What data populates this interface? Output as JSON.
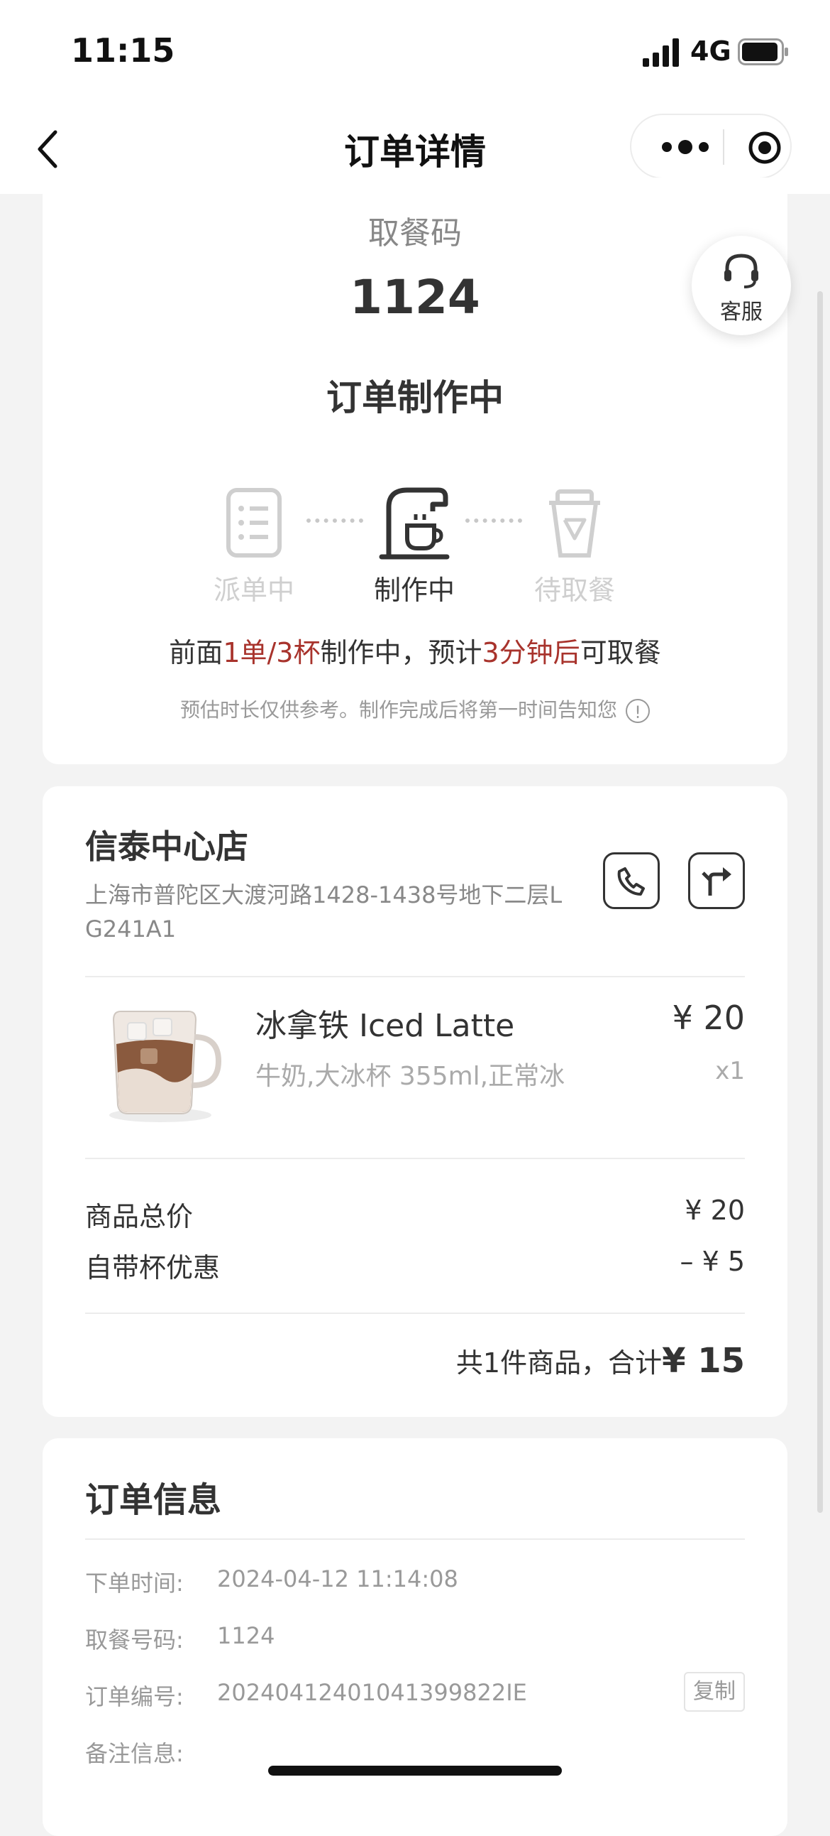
{
  "status_bar": {
    "time": "11:15",
    "network": "4G"
  },
  "nav": {
    "title": "订单详情"
  },
  "customer_service": {
    "label": "客服"
  },
  "pickup": {
    "label": "取餐码",
    "code": "1124",
    "status": "订单制作中"
  },
  "progress": {
    "steps": [
      {
        "label": "派单中",
        "state": "done",
        "icon": "order-list-icon"
      },
      {
        "label": "制作中",
        "state": "active",
        "icon": "coffee-machine-icon"
      },
      {
        "label": "待取餐",
        "state": "pending",
        "icon": "cup-icon"
      }
    ],
    "queue_prefix": "前面",
    "queue_count": "1单/3杯",
    "queue_mid": "制作中，预计",
    "queue_wait": "3分钟后",
    "queue_suffix": "可取餐",
    "note": "预估时长仅供参考。制作完成后将第一时间告知您",
    "note_icon": "!",
    "highlight_color": "#a8332c"
  },
  "store": {
    "name": "信泰中心店",
    "address": "上海市普陀区大渡河路1428-1438号地下二层LG241A1"
  },
  "product": {
    "name": "冰拿铁 Iced Latte",
    "spec": "牛奶,大冰杯 355ml,正常冰",
    "price": "¥ 20",
    "qty": "x1"
  },
  "summary": {
    "subtotal_label": "商品总价",
    "subtotal_value": "¥ 20",
    "discount_label": "自带杯优惠",
    "discount_value": "– ¥ 5",
    "total_prefix": "共1件商品，合计",
    "total_amount": "¥ 15"
  },
  "order_info": {
    "title": "订单信息",
    "rows": [
      {
        "label": "下单时间:",
        "value": "2024-04-12 11:14:08"
      },
      {
        "label": "取餐号码:",
        "value": "1124"
      },
      {
        "label": "订单编号:",
        "value": "20240412401041399822IE"
      },
      {
        "label": "备注信息:",
        "value": ""
      }
    ],
    "copy_label": "复制"
  }
}
